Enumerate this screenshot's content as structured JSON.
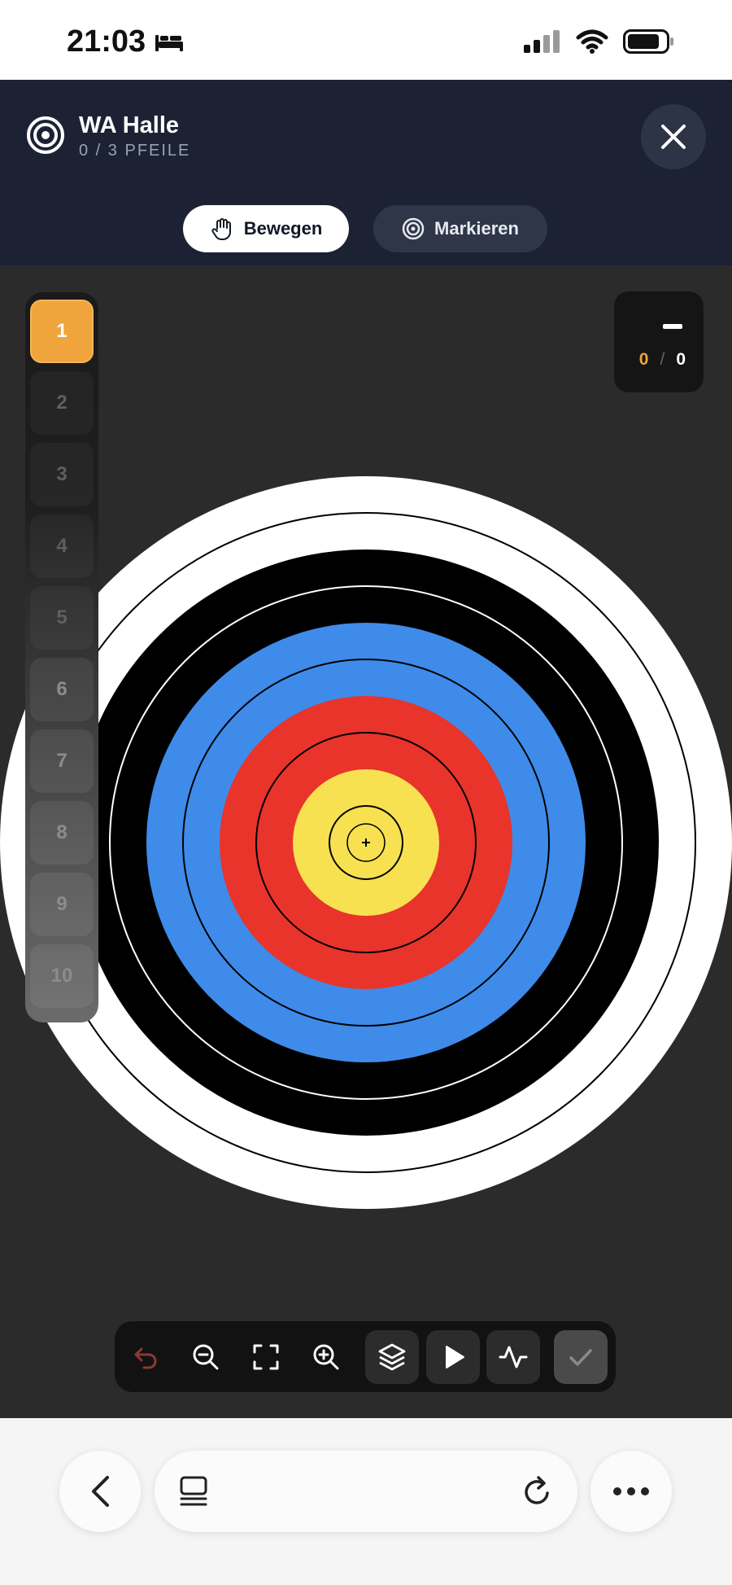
{
  "status": {
    "time": "21:03"
  },
  "header": {
    "title": "WA Halle",
    "subtitle": "0 / 3 PFEILE",
    "modes": [
      {
        "label": "Bewegen",
        "icon": "hand-icon",
        "active": true
      },
      {
        "label": "Markieren",
        "icon": "target-icon",
        "active": false
      }
    ]
  },
  "arrows": {
    "items": [
      "1",
      "2",
      "3",
      "4",
      "5",
      "6",
      "7",
      "8",
      "9",
      "10"
    ],
    "active_index": 0
  },
  "score": {
    "value": "",
    "hit": "0",
    "separator": "/",
    "total": "0"
  },
  "target": {
    "colors": {
      "white": "#ffffff",
      "black": "#000000",
      "blue": "#3e8bea",
      "red": "#e8342b",
      "yellow": "#f7e150"
    }
  },
  "toolbar": {
    "tools": [
      "undo-icon",
      "zoom-out-icon",
      "fit-screen-icon",
      "zoom-in-icon",
      "layers-icon",
      "play-icon",
      "activity-icon",
      "check-icon"
    ]
  },
  "browser": {
    "icons": [
      "back-icon",
      "tabs-icon",
      "reload-icon",
      "more-icon"
    ]
  },
  "colors": {
    "accent": "#f0a43c",
    "header_bg": "#1c2233",
    "canvas_bg": "#2b2b2b"
  }
}
